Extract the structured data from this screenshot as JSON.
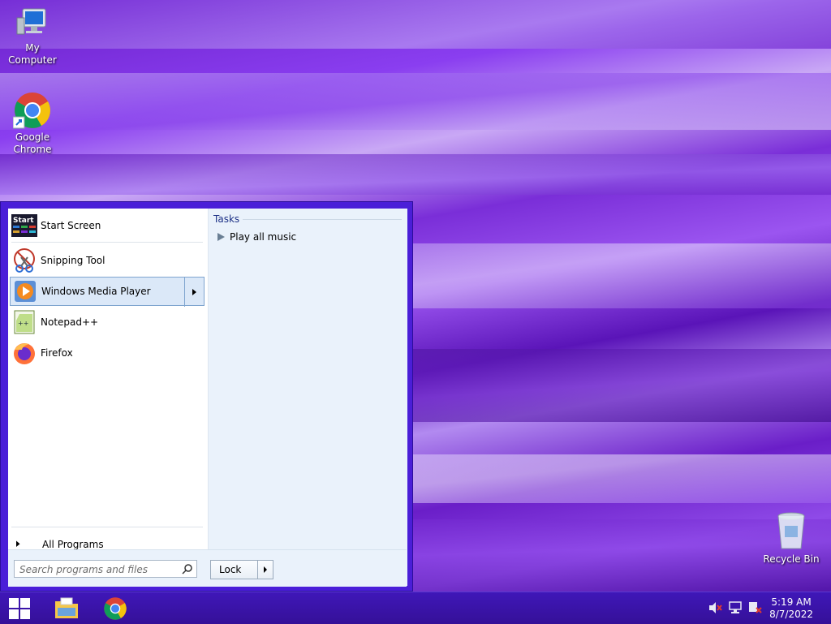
{
  "desktop": {
    "icons": [
      {
        "label": "My Computer",
        "icon": "computer-icon"
      },
      {
        "label": "Google Chrome",
        "icon": "chrome-icon"
      },
      {
        "label": "Recycle Bin",
        "icon": "recycle-bin-icon"
      }
    ]
  },
  "start_menu": {
    "items": [
      {
        "label": "Start Screen",
        "icon": "start-screen-icon"
      },
      {
        "label": "Snipping Tool",
        "icon": "snipping-tool-icon"
      },
      {
        "label": "Windows Media Player",
        "icon": "media-player-icon",
        "highlighted": true
      },
      {
        "label": "Notepad++",
        "icon": "notepadpp-icon"
      },
      {
        "label": "Firefox",
        "icon": "firefox-icon"
      }
    ],
    "start_screen_icon_text": "Start",
    "all_programs": "All Programs",
    "search_placeholder": "Search programs and files",
    "lock_label": "Lock",
    "tasks_heading": "Tasks",
    "task_play_all": "Play all music"
  },
  "taskbar": {
    "start_icon": "windows-logo-icon",
    "pinned": [
      "file-explorer-icon",
      "chrome-icon"
    ],
    "tray_icons": [
      "volume-muted-icon",
      "network-icon",
      "action-center-icon"
    ],
    "time": "5:19 AM",
    "date": "8/7/2022"
  },
  "colors": {
    "start_menu_frame": "#4a1ed8",
    "taskbar": "#3a13a8",
    "highlight": "#dbe8f8"
  }
}
